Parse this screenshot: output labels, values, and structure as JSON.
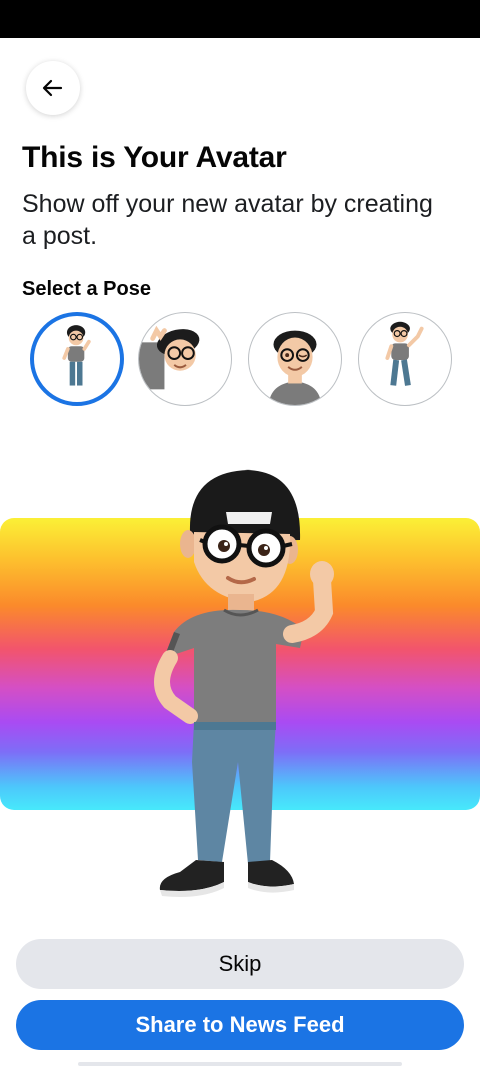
{
  "header": {
    "back_icon": "arrow-left-icon"
  },
  "content": {
    "title": "This is Your Avatar",
    "subtitle": "Show off your new avatar by creating a post.",
    "pose_section_label": "Select a Pose"
  },
  "poses": {
    "selected_index": 0,
    "items": [
      "full-body-hand-on-hip",
      "peeking-wave",
      "wink-portrait",
      "full-body-wave"
    ]
  },
  "colors": {
    "accent": "#1b74e4",
    "secondary_button": "#e4e6eb",
    "gradient": [
      "#fbf036",
      "#fb8a2b",
      "#f2546d",
      "#a94bf3",
      "#47e9fb"
    ]
  },
  "actions": {
    "skip_label": "Skip",
    "share_label": "Share to News Feed"
  }
}
